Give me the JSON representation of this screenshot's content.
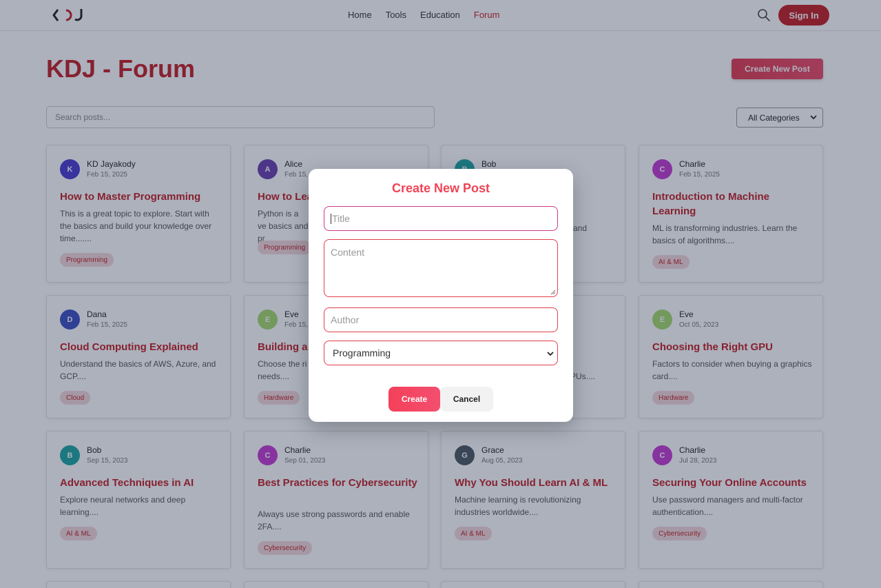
{
  "navbar": {
    "logo_text": "KDJ",
    "links": [
      "Home",
      "Tools",
      "Education",
      "Forum"
    ],
    "active_link": "Forum",
    "signin_label": "Sign In",
    "search_icon": "search-icon"
  },
  "page": {
    "title": "KDJ - Forum",
    "create_post_label": "Create New Post",
    "search_placeholder": "Search posts...",
    "category_filter": "All Categories"
  },
  "colors": {
    "brand_red": "#c51f24",
    "accent_pink": "#ef4456",
    "tag_bg": "#f4d8da"
  },
  "posts": [
    {
      "author": "KD Jayakody",
      "initial": "K",
      "avatar_color": "#4a3bd0",
      "date": "Feb 15, 2025",
      "title": "How to Master Programming",
      "excerpt": "This is a great topic to explore. Start with the basics and build your knowledge over time.......",
      "tag": "Programming"
    },
    {
      "author": "Alice",
      "initial": "A",
      "avatar_color": "#6b3fb0",
      "date": "Feb 15,",
      "title": "How to Lea",
      "excerpt": "Python is a ve basics and pr",
      "tag": "Programming"
    },
    {
      "author": "Bob",
      "initial": "B",
      "avatar_color": "#1ea7a1",
      "date": "",
      "title": "",
      "excerpt": "and",
      "tag": ""
    },
    {
      "author": "Charlie",
      "initial": "C",
      "avatar_color": "#c53bd2",
      "date": "Feb 15, 2025",
      "title": "Introduction to Machine Learning",
      "excerpt": "ML is transforming industries. Learn the basics of algorithms....",
      "tag": "AI & ML"
    },
    {
      "author": "Dana",
      "initial": "D",
      "avatar_color": "#3e4fc2",
      "date": "Feb 15, 2025",
      "title": "Cloud Computing Explained",
      "excerpt": "Understand the basics of AWS, Azure, and GCP....",
      "tag": "Cloud"
    },
    {
      "author": "Eve",
      "initial": "E",
      "avatar_color": "#a7d96b",
      "date": "Feb 15,",
      "title": "Building a",
      "excerpt": "Choose the ri needs....",
      "tag": "Hardware"
    },
    {
      "author": "",
      "initial": "",
      "avatar_color": "#ffffff",
      "date": "",
      "title": "",
      "excerpt": "PUs....",
      "tag": ""
    },
    {
      "author": "Eve",
      "initial": "E",
      "avatar_color": "#a7d96b",
      "date": "Oct 05, 2023",
      "title": "Choosing the Right GPU",
      "excerpt": "Factors to consider when buying a graphics card....",
      "tag": "Hardware"
    },
    {
      "author": "Bob",
      "initial": "B",
      "avatar_color": "#1ea7a1",
      "date": "Sep 15, 2023",
      "title": "Advanced Techniques in AI",
      "excerpt": "Explore neural networks and deep learning....",
      "tag": "AI & ML"
    },
    {
      "author": "Charlie",
      "initial": "C",
      "avatar_color": "#c53bd2",
      "date": "Sep 01, 2023",
      "title": "Best Practices for Cybersecurity",
      "excerpt": "Always use strong passwords and enable 2FA....",
      "tag": "Cybersecurity"
    },
    {
      "author": "Grace",
      "initial": "G",
      "avatar_color": "#4d5660",
      "date": "Aug 05, 2023",
      "title": "Why You Should Learn AI & ML",
      "excerpt": "Machine learning is revolutionizing industries worldwide....",
      "tag": "AI & ML"
    },
    {
      "author": "Charlie",
      "initial": "C",
      "avatar_color": "#c53bd2",
      "date": "Jul 28, 2023",
      "title": "Securing Your Online Accounts",
      "excerpt": "Use password managers and multi-factor authentication....",
      "tag": "Cybersecurity"
    }
  ],
  "modal": {
    "title": "Create New Post",
    "title_placeholder": "Title",
    "content_placeholder": "Content",
    "author_placeholder": "Author",
    "category_value": "Programming",
    "create_label": "Create",
    "cancel_label": "Cancel"
  }
}
